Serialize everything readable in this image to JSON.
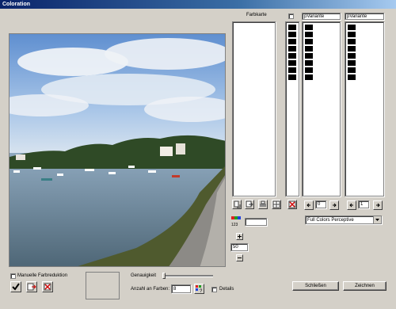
{
  "window": {
    "title": "Coloration"
  },
  "palette": {
    "farbkarte_label": "Farbkarte"
  },
  "variants": {
    "variant_a_value": "pVariante",
    "variant_b_value": "pVariante",
    "variant_a_index": "0",
    "variant_b_index": "1"
  },
  "colors": {
    "black": "#000000",
    "accent_red": "#cc0000"
  },
  "count_field": {
    "value": ""
  },
  "mode_select": {
    "value": "Full Colors Perceptive"
  },
  "zoom": {
    "value": "50"
  },
  "bottom": {
    "manual_reduction_label": "Manuelle Farbreduktion",
    "accuracy_label": "Genauigkeit",
    "num_colors_label": "Anzahl an Farben:",
    "num_colors_value": "8",
    "details_label": "Details",
    "close_label": "Schließen",
    "draw_label": "Zeichnen"
  }
}
